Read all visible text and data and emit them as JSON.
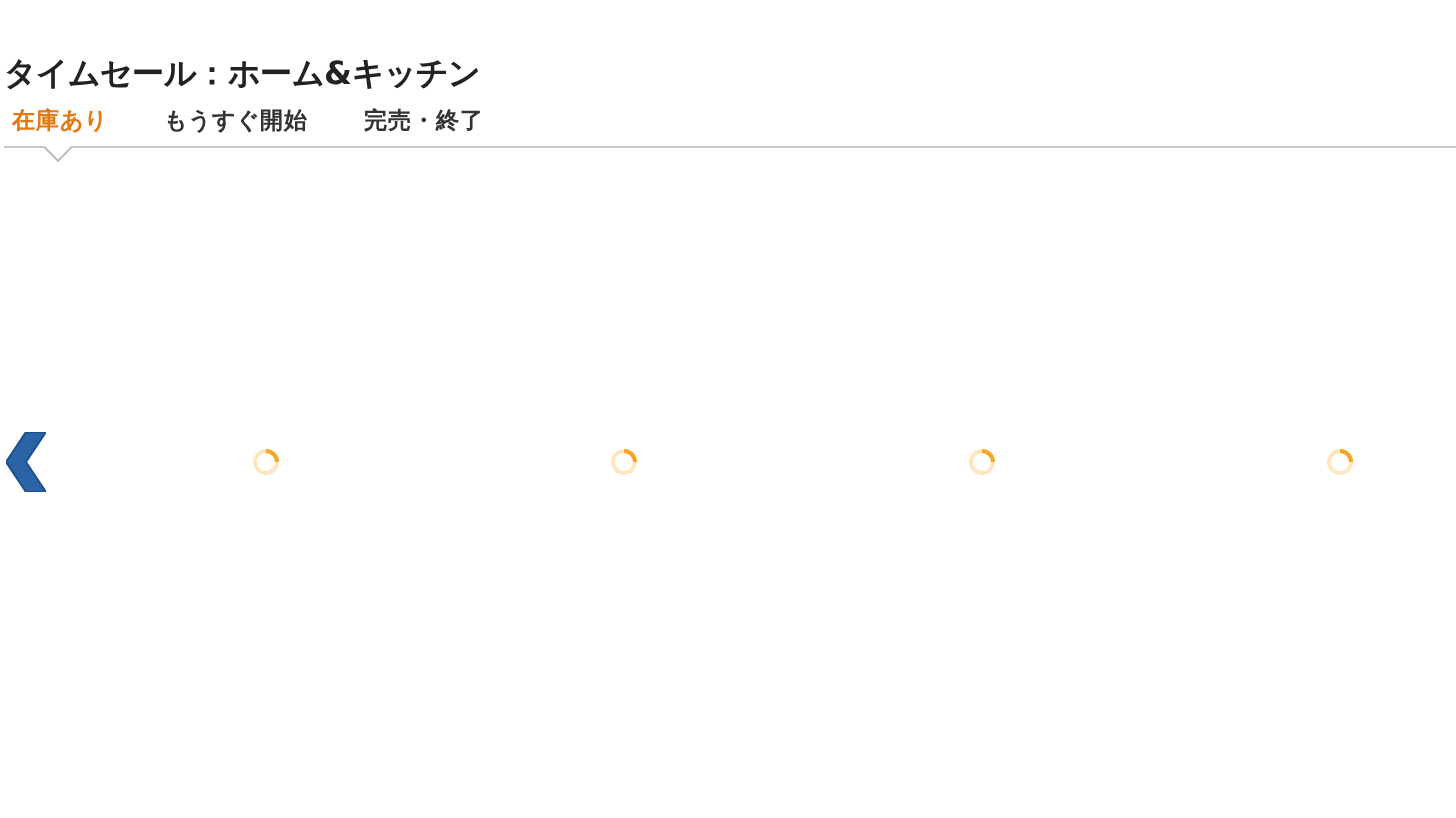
{
  "title": "タイムセール：ホーム&キッチン",
  "tabs": [
    {
      "label": "在庫あり",
      "selected": true
    },
    {
      "label": "もうすぐ開始",
      "selected": false
    },
    {
      "label": "完売・終了",
      "selected": false
    }
  ],
  "carousel": {
    "items": [
      {
        "kind": "loading"
      },
      {
        "kind": "loading"
      },
      {
        "kind": "loading"
      },
      {
        "kind": "loading"
      }
    ]
  }
}
